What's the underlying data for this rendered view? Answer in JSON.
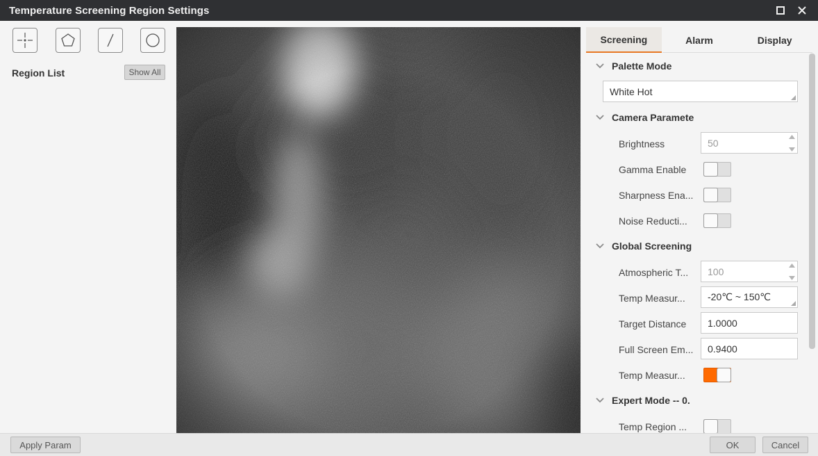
{
  "window": {
    "title": "Temperature Screening Region Settings",
    "icons": {
      "maximize": "maximize-icon",
      "close": "close-icon"
    }
  },
  "toolbar": {
    "tools": [
      {
        "name": "point-tool",
        "icon": "crosshair-point-icon"
      },
      {
        "name": "polygon-tool",
        "icon": "pentagon-icon"
      },
      {
        "name": "line-tool",
        "icon": "line-icon"
      },
      {
        "name": "circle-tool",
        "icon": "circle-icon"
      }
    ]
  },
  "region_list": {
    "label": "Region List",
    "show_all_label": "Show All"
  },
  "tabs": [
    {
      "label": "Screening",
      "active": true
    },
    {
      "label": "Alarm",
      "active": false
    },
    {
      "label": "Display",
      "active": false
    }
  ],
  "palette": {
    "section_label": "Palette Mode",
    "value": "White Hot"
  },
  "camera": {
    "section_label": "Camera Paramete",
    "brightness_label": "Brightness",
    "brightness_value": "50",
    "gamma_label": "Gamma Enable",
    "gamma_on": false,
    "sharpness_label": "Sharpness Ena...",
    "sharpness_on": false,
    "noise_label": "Noise Reducti...",
    "noise_on": false
  },
  "global": {
    "section_label": "Global Screening",
    "atmospheric_label": "Atmospheric T...",
    "atmospheric_value": "100",
    "temp_range_label": "Temp Measur...",
    "temp_range_value": "-20℃ ~ 150℃",
    "distance_label": "Target Distance",
    "distance_value": "1.0000",
    "emissivity_label": "Full Screen Em...",
    "emissivity_value": "0.9400",
    "temp_measure_label": "Temp Measur...",
    "temp_measure_on": true
  },
  "expert": {
    "section_label": "Expert Mode -- 0.",
    "temp_region_label": "Temp Region ...",
    "temp_region_on": false
  },
  "footer": {
    "apply_label": "Apply Param",
    "ok_label": "OK",
    "cancel_label": "Cancel"
  },
  "colors": {
    "accent": "#ff6a00",
    "titlebar": "#2f3033",
    "panel": "#f4f4f4"
  }
}
